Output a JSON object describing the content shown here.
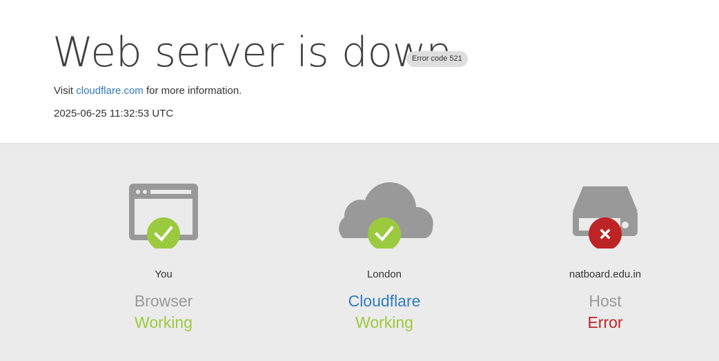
{
  "header": {
    "title": "Web server is down",
    "error_badge": "Error code 521",
    "visit_prefix": "Visit",
    "visit_link": "cloudflare.com",
    "visit_suffix": "for more information.",
    "timestamp": "2025-06-25 11:32:53 UTC"
  },
  "columns": [
    {
      "location": "You",
      "kind": "Browser",
      "status": "Working",
      "icon": "browser-icon",
      "status_icon": "check-icon"
    },
    {
      "location": "London",
      "kind": "Cloudflare",
      "status": "Working",
      "icon": "cloud-icon",
      "status_icon": "check-icon"
    },
    {
      "location": "natboard.edu.in",
      "kind": "Host",
      "status": "Error",
      "icon": "server-icon",
      "status_icon": "x-icon"
    }
  ],
  "colors": {
    "ok": "#9bca3e",
    "error": "#bd2426",
    "link": "#2f7bbf",
    "icon_gray": "#999999"
  }
}
